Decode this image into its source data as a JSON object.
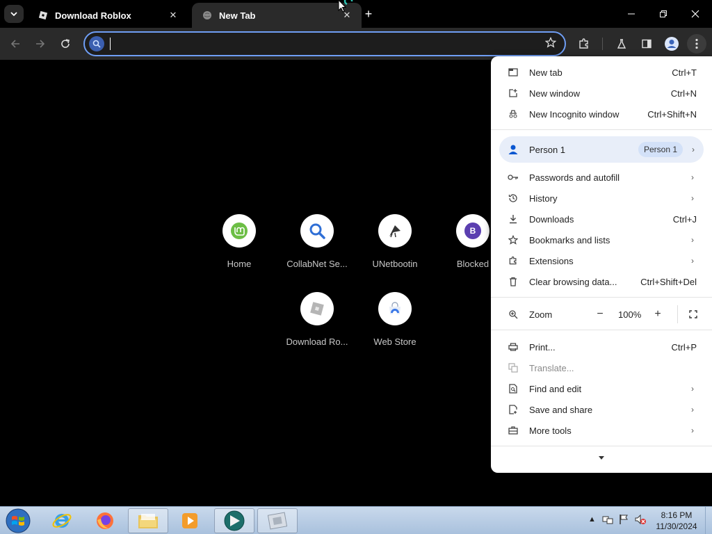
{
  "tabs": [
    {
      "title": "Download Roblox",
      "active": false
    },
    {
      "title": "New Tab",
      "active": true
    }
  ],
  "omnibox": {
    "value": "",
    "placeholder": ""
  },
  "shortcuts": [
    {
      "label": "Home",
      "icon": "linux-mint-icon"
    },
    {
      "label": "CollabNet Se...",
      "icon": "search-magnifier-icon"
    },
    {
      "label": "UNetbootin",
      "icon": "unetbootin-icon"
    },
    {
      "label": "Blocked",
      "icon": "letter-b-icon",
      "letter": "B"
    },
    {
      "label": "Download Ro...",
      "icon": "roblox-icon"
    },
    {
      "label": "Web Store",
      "icon": "web-store-icon"
    }
  ],
  "menu": {
    "new_tab": {
      "label": "New tab",
      "shortcut": "Ctrl+T"
    },
    "new_window": {
      "label": "New window",
      "shortcut": "Ctrl+N"
    },
    "new_incognito": {
      "label": "New Incognito window",
      "shortcut": "Ctrl+Shift+N"
    },
    "person": {
      "label": "Person 1",
      "chip": "Person 1"
    },
    "passwords": {
      "label": "Passwords and autofill"
    },
    "history": {
      "label": "History"
    },
    "downloads": {
      "label": "Downloads",
      "shortcut": "Ctrl+J"
    },
    "bookmarks": {
      "label": "Bookmarks and lists"
    },
    "extensions": {
      "label": "Extensions"
    },
    "clear_data": {
      "label": "Clear browsing data...",
      "shortcut": "Ctrl+Shift+Del"
    },
    "zoom": {
      "label": "Zoom",
      "value": "100%",
      "minus": "−",
      "plus": "+"
    },
    "print": {
      "label": "Print...",
      "shortcut": "Ctrl+P"
    },
    "translate": {
      "label": "Translate..."
    },
    "find_edit": {
      "label": "Find and edit"
    },
    "save_share": {
      "label": "Save and share"
    },
    "more_tools": {
      "label": "More tools"
    }
  },
  "taskbar": {
    "time": "8:16 PM",
    "date": "11/30/2024"
  },
  "colors": {
    "accent": "#6f9ef5",
    "toolbar": "#2a2a2a",
    "menu_bg": "#ffffff",
    "person_highlight": "#e8eef9"
  }
}
